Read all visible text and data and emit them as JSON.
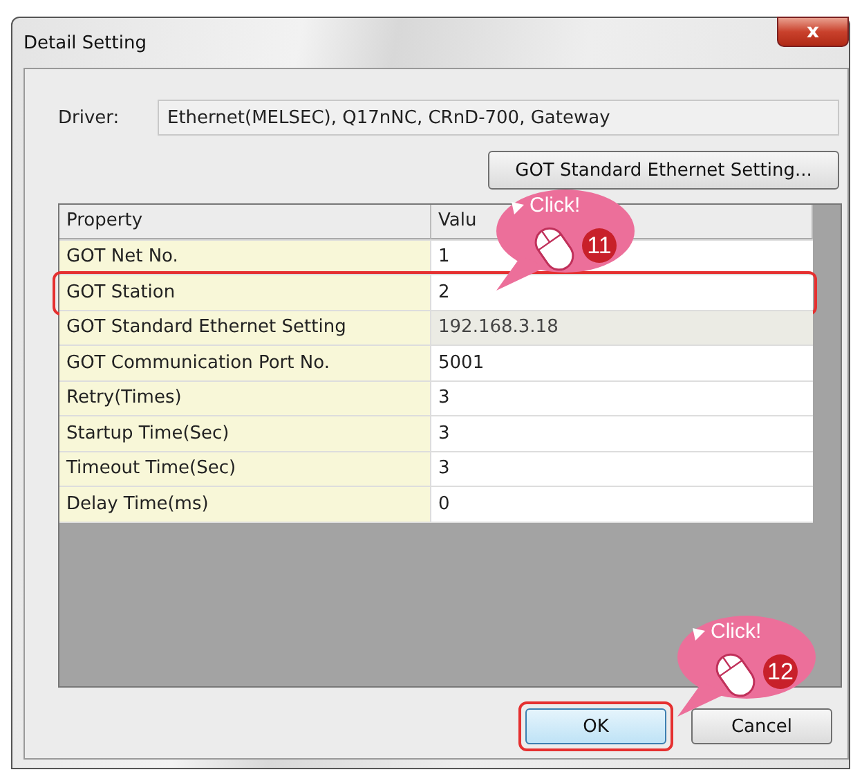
{
  "window": {
    "title": "Detail Setting",
    "close": "x"
  },
  "driver": {
    "label": "Driver:",
    "value": "Ethernet(MELSEC), Q17nNC, CRnD-700, Gateway"
  },
  "ethernet_button": {
    "label": "GOT Standard Ethernet Setting..."
  },
  "table": {
    "columns": [
      "Property",
      "Valu"
    ],
    "rows": [
      {
        "property": "GOT Net No.",
        "value": "1",
        "disabled": false,
        "highlighted": false
      },
      {
        "property": "GOT Station",
        "value": "2",
        "disabled": false,
        "highlighted": true
      },
      {
        "property": "GOT Standard Ethernet Setting",
        "value": "192.168.3.18",
        "disabled": true,
        "highlighted": false
      },
      {
        "property": "GOT Communication Port No.",
        "value": "5001",
        "disabled": false,
        "highlighted": false
      },
      {
        "property": "Retry(Times)",
        "value": "3",
        "disabled": false,
        "highlighted": false
      },
      {
        "property": "Startup Time(Sec)",
        "value": "3",
        "disabled": false,
        "highlighted": false
      },
      {
        "property": "Timeout Time(Sec)",
        "value": "3",
        "disabled": false,
        "highlighted": false
      },
      {
        "property": "Delay Time(ms)",
        "value": "0",
        "disabled": false,
        "highlighted": false
      }
    ]
  },
  "buttons": [
    {
      "label": "OK",
      "default": true,
      "highlighted": true
    },
    {
      "label": "Cancel",
      "default": false,
      "highlighted": false
    }
  ],
  "callouts": [
    {
      "text": "Click!",
      "step": "11"
    },
    {
      "text": "Click!",
      "step": "12"
    }
  ]
}
